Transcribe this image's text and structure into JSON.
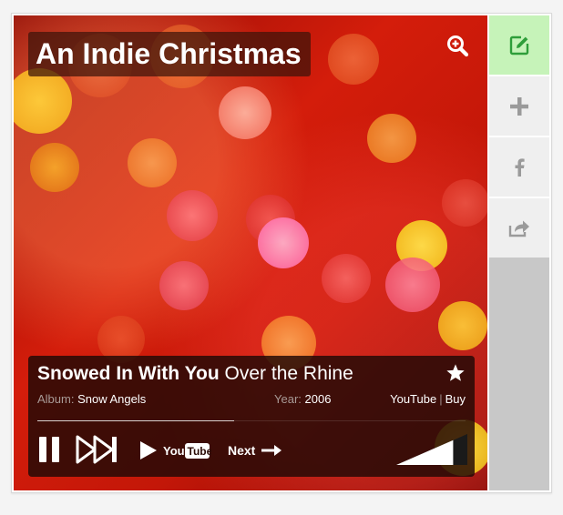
{
  "playlist": {
    "title": "An Indie Christmas"
  },
  "now_playing": {
    "song": "Snowed In With You",
    "artist": "Over the Rhine",
    "album_label": "Album:",
    "album": "Snow Angels",
    "year_label": "Year:",
    "year": "2006",
    "youtube_link": "YouTube",
    "separator": "|",
    "buy_link": "Buy",
    "progress_fraction": 0.46
  },
  "controls": {
    "pause_icon": "pause-icon",
    "skip_icon": "skip-forward-icon",
    "youtube_label_you": "You",
    "youtube_label_tube": "Tube",
    "next_label": "Next",
    "volume_level": 0.8
  },
  "sidebar": {
    "items": [
      {
        "name": "edit-icon",
        "color": "#2e9e3a"
      },
      {
        "name": "add-icon",
        "color": "#9a9a9a"
      },
      {
        "name": "facebook-icon",
        "color": "#9a9a9a"
      },
      {
        "name": "share-icon",
        "color": "#9a9a9a"
      }
    ]
  },
  "colors": {
    "edit_bg": "#c6f3b9",
    "sidebar_bg": "#c8c8c8",
    "player_bg": "#230a06"
  }
}
